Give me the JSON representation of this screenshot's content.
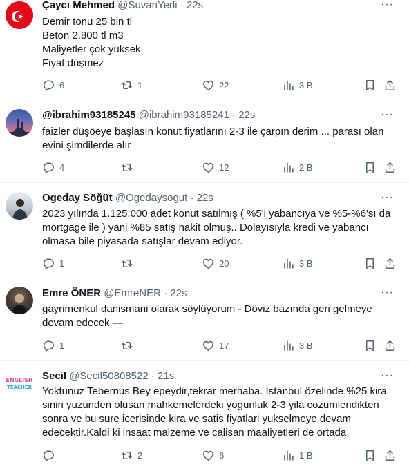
{
  "tweets": [
    {
      "name": "Çaycı Mehmed",
      "handle": "@SuvariYerli",
      "dot": "·",
      "time": "22s",
      "lines": [
        "Demir tonu 25 bin tl",
        "Beton 2.800 tl m3",
        "Maliyetler çok  yüksek",
        "Fiyat düşmez"
      ],
      "reply": "6",
      "retweet": "1",
      "like": "22",
      "views": "3 B"
    },
    {
      "name": "@ibrahim93185245",
      "handle": "@ibrahim93185241",
      "dot": "·",
      "time": "22s",
      "lines": [
        "faizler düşöeye başlasın konut fiyatlarını 2-3 ile çarpın derim ... parası olan",
        "evini şimdilerde alır"
      ],
      "reply": "4",
      "retweet": "",
      "like": "12",
      "views": "2 B"
    },
    {
      "name": "Ogeday Söğüt",
      "handle": "@Ogedaysogut",
      "dot": "·",
      "time": "22s",
      "lines": [
        "2023 yılında 1.125.000 adet konut satılmış ( %5'i yabancıya ve %5-%6'sı da",
        "mortgage ile ) yani %85 satış nakit olmuş.. Dolayısıyla kredi ve yabancı",
        "olmasa bile piyasada satışlar devam ediyor."
      ],
      "reply": "1",
      "retweet": "",
      "like": "20",
      "views": "3 B"
    },
    {
      "name": "Emre ÖNER",
      "handle": "@EmreNER",
      "dot": "·",
      "time": "22s",
      "lines": [
        "gayrimenkul danismani olarak söylüyorum - Döviz bazında geri gelmeye",
        "devam edecek —"
      ],
      "reply": "1",
      "retweet": "",
      "like": "17",
      "views": "3 B"
    },
    {
      "name": "Secil",
      "handle": "@Secil50808522",
      "dot": "·",
      "time": "21s",
      "lines": [
        "Yoktunuz Tebernus Bey epeydir,tekrar merhaba. Istanbul özelinde,%25 kira",
        "siniri yuzunden olusan mahkemelerdeki yogunluk 2-3 yila cozumlendikten",
        "sonra ve bu sure icerisinde kira ve satis fiyatlari yukselmeye devam",
        "edecektir.Kaldi ki insaat malzeme ve calisan maaliyetleri de ortada"
      ],
      "reply": "",
      "retweet": "2",
      "like": "6",
      "views": "1 B"
    }
  ],
  "more_label": "···",
  "avatar_texts": {
    "secil": [
      "ENGLISH",
      "TEACHER"
    ]
  },
  "colors": {
    "secondary_text": "#536471",
    "primary_text": "#0f1419",
    "divider": "#eff3f4",
    "turkey_red": "#e30a17"
  },
  "icons": [
    "reply-icon",
    "retweet-icon",
    "like-icon",
    "views-icon",
    "bookmark-icon",
    "share-icon",
    "more-icon"
  ]
}
